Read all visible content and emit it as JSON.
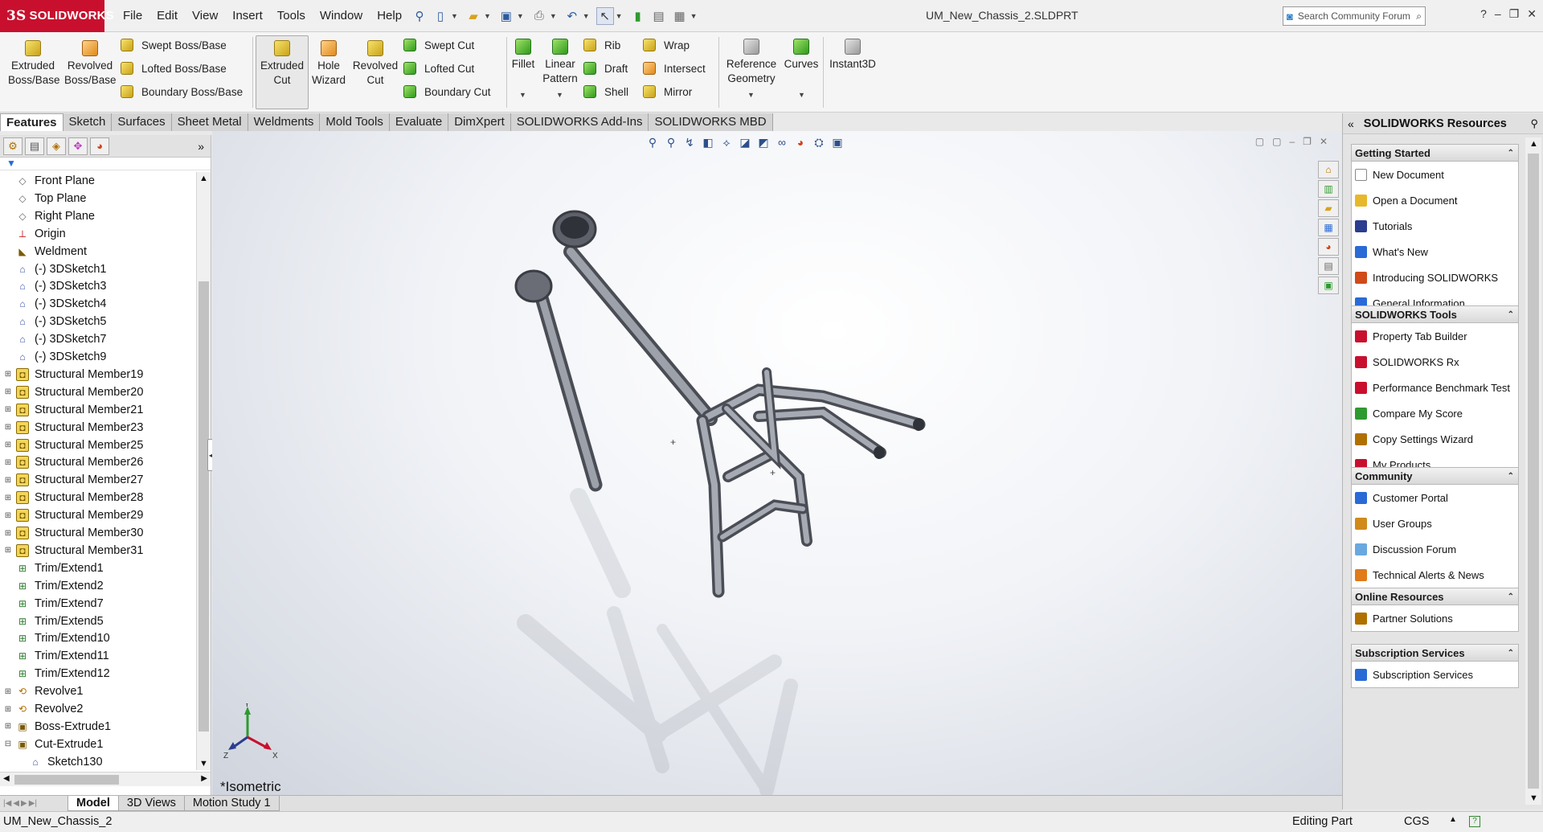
{
  "app": {
    "brand": "SOLIDWORKS",
    "document_title": "UM_New_Chassis_2.SLDPRT",
    "menu": [
      "File",
      "Edit",
      "View",
      "Insert",
      "Tools",
      "Window",
      "Help"
    ],
    "search_placeholder": "Search Community Forum"
  },
  "ribbon": {
    "extruded_boss": "Extruded\nBoss/Base",
    "revolved_boss": "Revolved\nBoss/Base",
    "swept_boss": "Swept Boss/Base",
    "lofted_boss": "Lofted Boss/Base",
    "boundary_boss": "Boundary Boss/Base",
    "extruded_cut": "Extruded\nCut",
    "hole_wizard": "Hole\nWizard",
    "revolved_cut": "Revolved\nCut",
    "swept_cut": "Swept Cut",
    "lofted_cut": "Lofted Cut",
    "boundary_cut": "Boundary Cut",
    "fillet": "Fillet",
    "linear_pattern": "Linear\nPattern",
    "rib": "Rib",
    "draft": "Draft",
    "shell": "Shell",
    "wrap": "Wrap",
    "intersect": "Intersect",
    "mirror": "Mirror",
    "reference_geometry": "Reference\nGeometry",
    "curves": "Curves",
    "instant3d": "Instant3D"
  },
  "tabs": [
    "Features",
    "Sketch",
    "Surfaces",
    "Sheet Metal",
    "Weldments",
    "Mold Tools",
    "Evaluate",
    "DimXpert",
    "SOLIDWORKS Add-Ins",
    "SOLIDWORKS MBD"
  ],
  "feature_tree": [
    {
      "label": "Front Plane",
      "icon": "plane-icon",
      "expandable": false
    },
    {
      "label": "Top Plane",
      "icon": "plane-icon",
      "expandable": false
    },
    {
      "label": "Right Plane",
      "icon": "plane-icon",
      "expandable": false
    },
    {
      "label": "Origin",
      "icon": "origin-icon",
      "expandable": false
    },
    {
      "label": "Weldment",
      "icon": "weldment-icon",
      "expandable": false
    },
    {
      "label": "(-) 3DSketch1",
      "icon": "3dsketch-icon",
      "expandable": false
    },
    {
      "label": "(-) 3DSketch3",
      "icon": "3dsketch-icon",
      "expandable": false
    },
    {
      "label": "(-) 3DSketch4",
      "icon": "3dsketch-icon",
      "expandable": false
    },
    {
      "label": "(-) 3DSketch5",
      "icon": "3dsketch-icon",
      "expandable": false
    },
    {
      "label": "(-) 3DSketch7",
      "icon": "3dsketch-icon",
      "expandable": false
    },
    {
      "label": "(-) 3DSketch9",
      "icon": "3dsketch-icon",
      "expandable": false
    },
    {
      "label": "Structural Member19",
      "icon": "structural-member-icon",
      "expandable": true
    },
    {
      "label": "Structural Member20",
      "icon": "structural-member-icon",
      "expandable": true
    },
    {
      "label": "Structural Member21",
      "icon": "structural-member-icon",
      "expandable": true
    },
    {
      "label": "Structural Member23",
      "icon": "structural-member-icon",
      "expandable": true
    },
    {
      "label": "Structural Member25",
      "icon": "structural-member-icon",
      "expandable": true
    },
    {
      "label": "Structural Member26",
      "icon": "structural-member-icon",
      "expandable": true
    },
    {
      "label": "Structural Member27",
      "icon": "structural-member-icon",
      "expandable": true
    },
    {
      "label": "Structural Member28",
      "icon": "structural-member-icon",
      "expandable": true
    },
    {
      "label": "Structural Member29",
      "icon": "structural-member-icon",
      "expandable": true
    },
    {
      "label": "Structural Member30",
      "icon": "structural-member-icon",
      "expandable": true
    },
    {
      "label": "Structural Member31",
      "icon": "structural-member-icon",
      "expandable": true
    },
    {
      "label": "Trim/Extend1",
      "icon": "trim-extend-icon",
      "expandable": false
    },
    {
      "label": "Trim/Extend2",
      "icon": "trim-extend-icon",
      "expandable": false
    },
    {
      "label": "Trim/Extend7",
      "icon": "trim-extend-icon",
      "expandable": false
    },
    {
      "label": "Trim/Extend5",
      "icon": "trim-extend-icon",
      "expandable": false
    },
    {
      "label": "Trim/Extend10",
      "icon": "trim-extend-icon",
      "expandable": false
    },
    {
      "label": "Trim/Extend11",
      "icon": "trim-extend-icon",
      "expandable": false
    },
    {
      "label": "Trim/Extend12",
      "icon": "trim-extend-icon",
      "expandable": false
    },
    {
      "label": "Revolve1",
      "icon": "revolve-icon",
      "expandable": true
    },
    {
      "label": "Revolve2",
      "icon": "revolve-icon",
      "expandable": true
    },
    {
      "label": "Boss-Extrude1",
      "icon": "boss-extrude-icon",
      "expandable": true
    },
    {
      "label": "Cut-Extrude1",
      "icon": "cut-extrude-icon",
      "expandable": "open"
    },
    {
      "label": "Sketch130",
      "icon": "sketch-icon",
      "expandable": false,
      "child": true
    }
  ],
  "viewport": {
    "view_label": "*Isometric",
    "triad": {
      "x": "X",
      "y": "Y",
      "z": "Z"
    }
  },
  "resources": {
    "title": "SOLIDWORKS Resources",
    "groups": [
      {
        "title": "Getting Started",
        "items": [
          {
            "label": "New Document",
            "icon": "new-document-icon",
            "color": "#ffffff"
          },
          {
            "label": "Open a Document",
            "icon": "open-folder-icon",
            "color": "#e7b82a"
          },
          {
            "label": "Tutorials",
            "icon": "mortarboard-icon",
            "color": "#2a3d8f"
          },
          {
            "label": "What's New",
            "icon": "question-icon",
            "color": "#2a6ad6"
          },
          {
            "label": "Introducing SOLIDWORKS",
            "icon": "intro-icon",
            "color": "#d04a1a"
          },
          {
            "label": "General Information",
            "icon": "info-icon",
            "color": "#2a6ad6"
          }
        ]
      },
      {
        "title": "SOLIDWORKS Tools",
        "items": [
          {
            "label": "Property Tab Builder",
            "icon": "property-tab-icon",
            "color": "#c8102e"
          },
          {
            "label": "SOLIDWORKS Rx",
            "icon": "rx-icon",
            "color": "#c8102e"
          },
          {
            "label": "Performance Benchmark Test",
            "icon": "benchmark-icon",
            "color": "#c8102e"
          },
          {
            "label": "Compare My Score",
            "icon": "compare-icon",
            "color": "#2f9a2f"
          },
          {
            "label": "Copy Settings Wizard",
            "icon": "wizard-icon",
            "color": "#b07000"
          },
          {
            "label": "My Products",
            "icon": "products-icon",
            "color": "#c8102e"
          }
        ]
      },
      {
        "title": "Community",
        "items": [
          {
            "label": "Customer Portal",
            "icon": "portal-icon",
            "color": "#2a6ad6"
          },
          {
            "label": "User Groups",
            "icon": "user-groups-icon",
            "color": "#d08a1a"
          },
          {
            "label": "Discussion Forum",
            "icon": "forum-icon",
            "color": "#6aa8e0"
          },
          {
            "label": "Technical Alerts & News",
            "icon": "rss-icon",
            "color": "#e07a1a"
          }
        ]
      },
      {
        "title": "Online Resources",
        "items": [
          {
            "label": "Partner Solutions",
            "icon": "partner-icon",
            "color": "#b07000"
          }
        ]
      },
      {
        "title": "Subscription Services",
        "items": [
          {
            "label": "Subscription Services",
            "icon": "subscription-icon",
            "color": "#2a6ad6"
          }
        ]
      }
    ]
  },
  "bottom_tabs": [
    "Model",
    "3D Views",
    "Motion Study 1"
  ],
  "status": {
    "document": "UM_New_Chassis_2",
    "mode": "Editing Part",
    "units": "CGS"
  },
  "colors": {
    "brand_red": "#c8102e",
    "frame_metal": "#8c8f97",
    "tree_selection": "#2a6ad6"
  }
}
